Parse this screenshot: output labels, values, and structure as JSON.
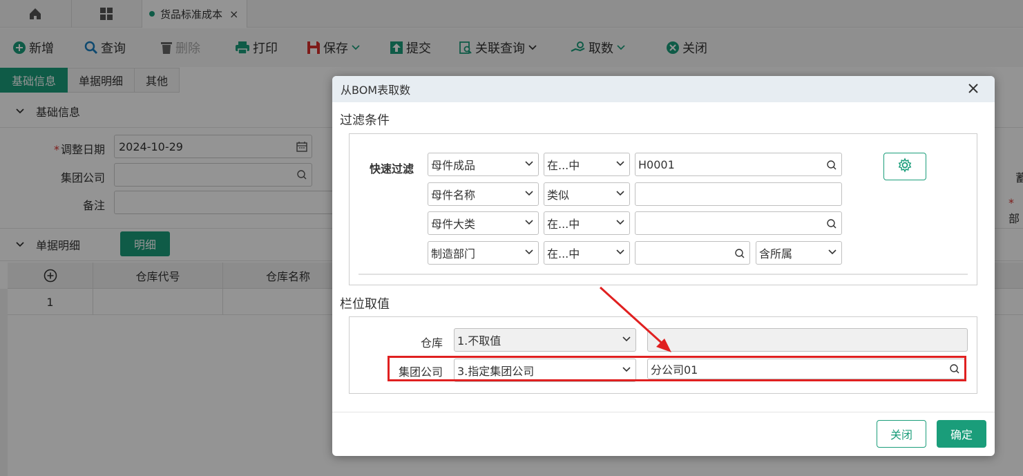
{
  "tabs": {
    "home_icon": "home-icon",
    "apps_icon": "grid-icon",
    "doc_title": "货品标准成本",
    "close_glyph": "×"
  },
  "toolbar": {
    "add": "新增",
    "query": "查询",
    "delete": "删除",
    "print": "打印",
    "save": "保存",
    "submit": "提交",
    "related_query": "关联查询",
    "fetch": "取数",
    "close": "关闭"
  },
  "subtabs": [
    "基础信息",
    "单据明细",
    "其他"
  ],
  "basic_section": {
    "title": "基础信息",
    "adjust_date_label": "调整日期",
    "adjust_date_value": "2024-10-29",
    "group_company_label": "集团公司",
    "remark_label": "备注",
    "right_label_1": "蓄",
    "right_label_2": "部"
  },
  "detail_section": {
    "title": "单据明细",
    "detail_button": "明细",
    "columns": [
      "仓库代号",
      "仓库名称"
    ],
    "rows": [
      {
        "no": "1"
      }
    ]
  },
  "dialog": {
    "title": "从BOM表取数",
    "filter_title": "过滤条件",
    "quick_filter_label": "快速过滤",
    "filters": [
      {
        "field": "母件成品",
        "op": "在...中",
        "value": "H0001"
      },
      {
        "field": "母件名称",
        "op": "类似",
        "value": ""
      },
      {
        "field": "母件大类",
        "op": "在...中",
        "value": ""
      },
      {
        "field": "制造部门",
        "op": "在...中",
        "value": "",
        "extra": "含所属"
      }
    ],
    "column_title": "栏位取值",
    "column_rows": [
      {
        "label": "仓库",
        "mode": "1.不取值",
        "value": ""
      },
      {
        "label": "集团公司",
        "mode": "3.指定集团公司",
        "value": "分公司01"
      }
    ],
    "close_button": "关闭",
    "confirm_button": "确定"
  },
  "colors": {
    "accent": "#1a9d7a",
    "highlight": "#e02020"
  }
}
